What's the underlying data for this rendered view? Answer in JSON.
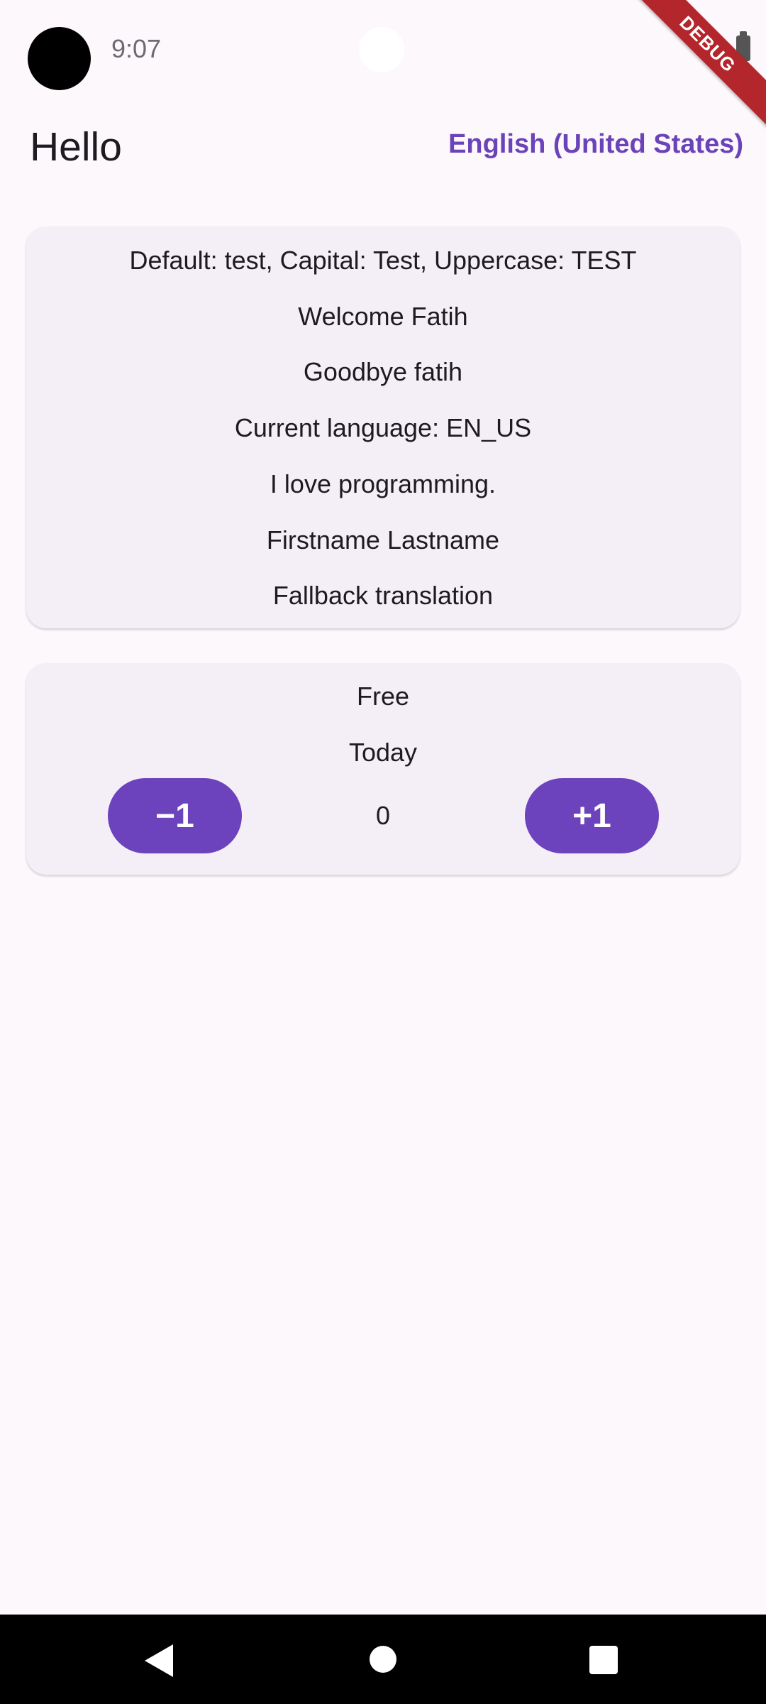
{
  "status_bar": {
    "time": "9:07"
  },
  "debug_banner": "DEBUG",
  "header": {
    "title": "Hello",
    "language_label": "English (United States)"
  },
  "translations_card": {
    "lines": [
      "Default: test, Capital: Test, Uppercase: TEST",
      "Welcome Fatih",
      "Goodbye fatih",
      "Current language: EN_US",
      "I love programming.",
      "Firstname Lastname",
      "Fallback translation"
    ]
  },
  "counter_card": {
    "price_label": "Free",
    "date_label": "Today",
    "decrement_label": "−1",
    "increment_label": "+1",
    "count": "0"
  },
  "colors": {
    "accent": "#6d42bd",
    "link": "#6b43b8",
    "background": "#fdf8fc",
    "card": "#f4eff7",
    "debug_ribbon": "#b3262b"
  },
  "nav_bar": {
    "icons": [
      "back-icon",
      "home-icon",
      "recents-icon"
    ]
  }
}
